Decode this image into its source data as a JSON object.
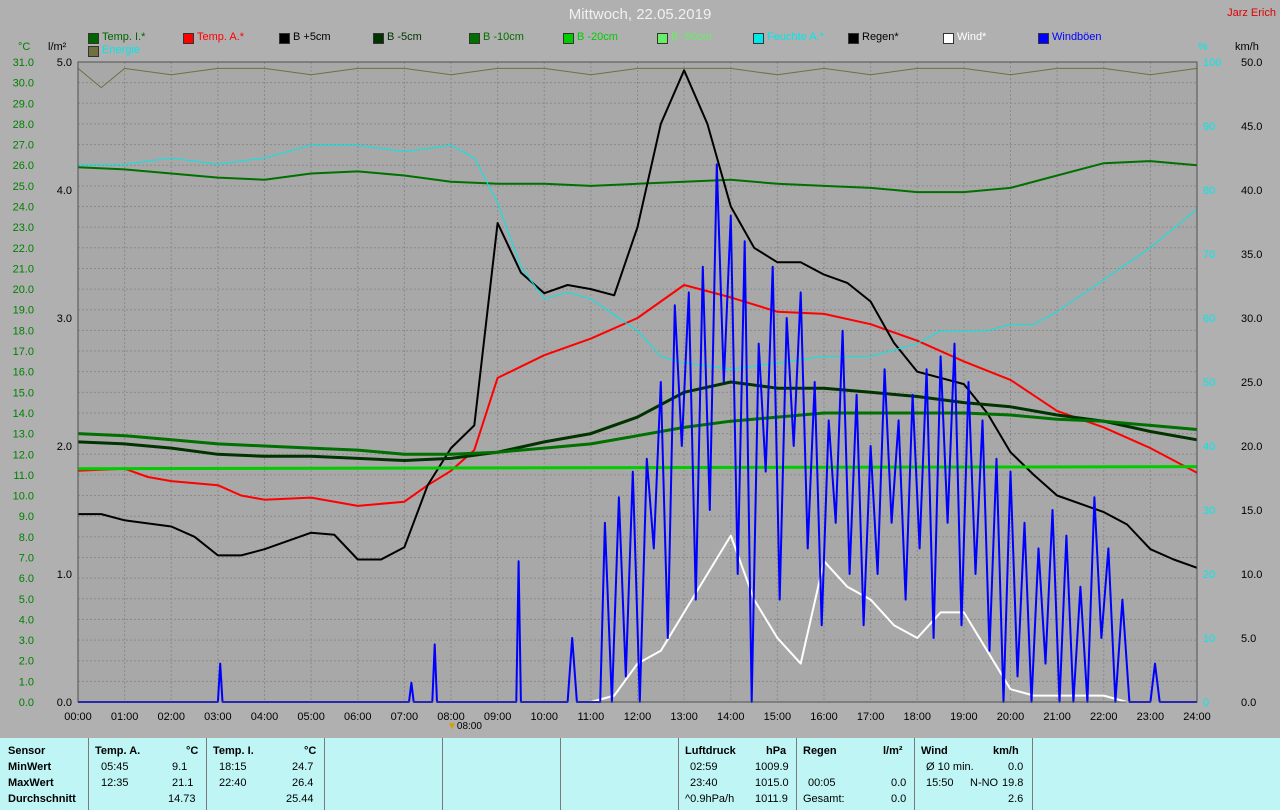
{
  "title": "Mittwoch, 22.05.2019",
  "author": "Jarz Erich",
  "units": {
    "left_temp": "°C",
    "left_rain": "l/m²",
    "right_pct": "%",
    "right_wind": "km/h"
  },
  "legend": [
    {
      "label": "Temp. I.*",
      "color": "#006400"
    },
    {
      "label": "Temp. A.*",
      "color": "#ff0000"
    },
    {
      "label": "B +5cm",
      "color": "#000000"
    },
    {
      "label": "B -5cm",
      "color": "#003300"
    },
    {
      "label": "B -10cm",
      "color": "#007000"
    },
    {
      "label": "B -20cm",
      "color": "#00cc00"
    },
    {
      "label": "B -50cm",
      "color": "#66ee66"
    },
    {
      "label": "Feuchte A.*",
      "color": "#00e8e8"
    },
    {
      "label": "Regen*",
      "color": "#000000"
    },
    {
      "label": "Wind*",
      "color": "#ffffff"
    },
    {
      "label": "Windböen",
      "color": "#0000ff"
    },
    {
      "label": "Energie",
      "color": "#707040"
    }
  ],
  "marker_label": "08:00",
  "chart_data": {
    "type": "line",
    "x_ticks": [
      "00:00",
      "01:00",
      "02:00",
      "03:00",
      "04:00",
      "05:00",
      "06:00",
      "07:00",
      "08:00",
      "09:00",
      "10:00",
      "11:00",
      "12:00",
      "13:00",
      "14:00",
      "15:00",
      "16:00",
      "17:00",
      "18:00",
      "19:00",
      "20:00",
      "21:00",
      "22:00",
      "23:00",
      "24:00"
    ],
    "temp_ticks": [
      "31.0",
      "30.0",
      "29.0",
      "28.0",
      "27.0",
      "26.0",
      "25.0",
      "24.0",
      "23.0",
      "22.0",
      "21.0",
      "20.0",
      "19.0",
      "18.0",
      "17.0",
      "16.0",
      "15.0",
      "14.0",
      "13.0",
      "12.0",
      "11.0",
      "10.0",
      "9.0",
      "8.0",
      "7.0",
      "6.0",
      "5.0",
      "4.0",
      "3.0",
      "2.0",
      "1.0",
      "0.0"
    ],
    "rain_ticks": [
      "5.0",
      "4.0",
      "3.0",
      "2.0",
      "1.0",
      "0.0"
    ],
    "pct_ticks": [
      "100",
      "90",
      "80",
      "70",
      "60",
      "50",
      "40",
      "30",
      "20",
      "10",
      "0"
    ],
    "wind_ticks": [
      "50.0",
      "45.0",
      "40.0",
      "35.0",
      "30.0",
      "25.0",
      "20.0",
      "15.0",
      "10.0",
      "5.0",
      "0.0"
    ],
    "temp_range": [
      0,
      31
    ],
    "pct_range": [
      0,
      100
    ],
    "wind_range": [
      0,
      50
    ],
    "series": [
      {
        "name": "Temp. I.*",
        "axis": "temp",
        "color": "#007000",
        "width": 2,
        "x": [
          0,
          1,
          2,
          3,
          4,
          5,
          6,
          7,
          8,
          9,
          10,
          11,
          12,
          13,
          14,
          15,
          16,
          17,
          18,
          19,
          20,
          21,
          22,
          23,
          24
        ],
        "y": [
          25.9,
          25.8,
          25.6,
          25.4,
          25.3,
          25.6,
          25.7,
          25.5,
          25.2,
          25.1,
          25.1,
          25.0,
          25.1,
          25.2,
          25.3,
          25.1,
          25.0,
          24.9,
          24.7,
          24.7,
          24.9,
          25.5,
          26.1,
          26.2,
          26.0
        ]
      },
      {
        "name": "Temp. A.*",
        "axis": "temp",
        "color": "#ff0000",
        "width": 2,
        "x": [
          0,
          1,
          1.5,
          2,
          3,
          3.5,
          4,
          5,
          6,
          7,
          7.5,
          8,
          8.5,
          9,
          10,
          11,
          12,
          13,
          14,
          15,
          16,
          17,
          18,
          19,
          20,
          21,
          22,
          23,
          24
        ],
        "y": [
          11.2,
          11.3,
          10.9,
          10.7,
          10.5,
          10.0,
          9.8,
          9.9,
          9.5,
          9.7,
          10.5,
          11.2,
          12.2,
          15.7,
          16.8,
          17.6,
          18.6,
          20.2,
          19.6,
          18.9,
          18.8,
          18.3,
          17.5,
          16.5,
          15.6,
          14.1,
          13.3,
          12.3,
          11.1
        ]
      },
      {
        "name": "B +5cm",
        "axis": "temp",
        "color": "#000000",
        "width": 2,
        "x": [
          0,
          0.5,
          1,
          2,
          2.5,
          3,
          3.5,
          4,
          5,
          5.5,
          6,
          6.5,
          7,
          7.5,
          8,
          8.5,
          9,
          9.5,
          10,
          10.5,
          11,
          11.5,
          12,
          12.5,
          13,
          13.5,
          14,
          14.5,
          15,
          15.5,
          16,
          16.5,
          17,
          17.5,
          18,
          19,
          19.5,
          20,
          20.5,
          21,
          22,
          22.5,
          23,
          23.5,
          24
        ],
        "y": [
          9.1,
          9.1,
          8.8,
          8.5,
          8.0,
          7.1,
          7.1,
          7.4,
          8.2,
          8.1,
          6.9,
          6.9,
          7.5,
          10.5,
          12.3,
          13.4,
          23.2,
          20.8,
          19.8,
          20.2,
          20.0,
          19.7,
          23.0,
          28.0,
          30.6,
          28.0,
          24.0,
          22.0,
          21.3,
          21.3,
          20.7,
          20.3,
          19.4,
          17.4,
          16.0,
          15.4,
          14.0,
          12.1,
          11.0,
          10.0,
          9.2,
          8.6,
          7.4,
          6.9,
          6.5
        ]
      },
      {
        "name": "B -5cm",
        "axis": "temp",
        "color": "#003300",
        "width": 3,
        "x": [
          0,
          1,
          2,
          3,
          4,
          5,
          6,
          7,
          8,
          9,
          10,
          11,
          12,
          13,
          14,
          15,
          16,
          17,
          18,
          19,
          20,
          21,
          22,
          23,
          24
        ],
        "y": [
          12.6,
          12.5,
          12.3,
          12.0,
          11.9,
          11.9,
          11.8,
          11.7,
          11.8,
          12.1,
          12.6,
          13.0,
          13.8,
          15.0,
          15.5,
          15.2,
          15.2,
          15.0,
          14.8,
          14.5,
          14.3,
          13.9,
          13.6,
          13.1,
          12.7
        ]
      },
      {
        "name": "B -10cm",
        "axis": "temp",
        "color": "#007000",
        "width": 3,
        "x": [
          0,
          1,
          2,
          3,
          4,
          5,
          6,
          7,
          8,
          9,
          10,
          11,
          12,
          13,
          14,
          15,
          16,
          17,
          18,
          19,
          20,
          21,
          22,
          23,
          24
        ],
        "y": [
          13.0,
          12.9,
          12.7,
          12.5,
          12.4,
          12.3,
          12.2,
          12.0,
          12.0,
          12.1,
          12.3,
          12.5,
          12.9,
          13.3,
          13.6,
          13.8,
          14.0,
          14.0,
          14.0,
          14.0,
          13.9,
          13.7,
          13.6,
          13.4,
          13.2
        ]
      },
      {
        "name": "B -20cm",
        "axis": "temp",
        "color": "#00cc00",
        "width": 3,
        "x": [
          0,
          24
        ],
        "y": [
          11.3,
          11.4
        ]
      },
      {
        "name": "Feuchte A.*",
        "axis": "pct",
        "color": "#00e8e8",
        "width": 1,
        "x": [
          0,
          1,
          2,
          3,
          4,
          5,
          6,
          7,
          8,
          8.5,
          9,
          9.5,
          10,
          10.5,
          11,
          12,
          12.5,
          13,
          14,
          15,
          16,
          17,
          18,
          18.5,
          19,
          19.5,
          20,
          20.5,
          21,
          22,
          23,
          24
        ],
        "y": [
          84,
          84,
          85,
          84,
          85,
          87,
          87,
          86,
          87,
          85,
          78,
          68,
          63,
          64,
          63,
          58,
          54,
          53,
          52,
          53,
          54,
          54,
          56,
          58,
          58,
          58,
          59,
          59,
          61,
          66,
          71,
          77
        ]
      },
      {
        "name": "Energie",
        "axis": "pct",
        "color": "#707040",
        "width": 1,
        "x": [
          0,
          0.5,
          1,
          2,
          3,
          4,
          5,
          6,
          7,
          8,
          9,
          10,
          11,
          12,
          13,
          14,
          15,
          16,
          17,
          18,
          19,
          20,
          21,
          22,
          23,
          24
        ],
        "y": [
          99,
          96,
          99,
          98,
          99,
          99,
          98,
          99,
          99,
          98,
          99,
          99,
          98,
          99,
          99,
          99,
          98,
          99,
          98,
          99,
          99,
          98,
          99,
          99,
          98,
          99
        ]
      },
      {
        "name": "Wind*",
        "axis": "wind",
        "color": "#ffffff",
        "width": 2,
        "x": [
          0,
          11,
          11.5,
          12,
          12.5,
          13,
          13.5,
          14,
          14.5,
          15,
          15.5,
          16,
          16.5,
          17,
          17.5,
          18,
          18.5,
          19,
          19.5,
          20,
          20.5,
          21,
          22,
          22.5,
          24
        ],
        "y": [
          0,
          0,
          0.5,
          3,
          4,
          7,
          10,
          13,
          8,
          5,
          3,
          11,
          9,
          8,
          6,
          5,
          7,
          7,
          4,
          1,
          0.5,
          0.5,
          0.5,
          0,
          0
        ]
      },
      {
        "name": "Windböen",
        "axis": "wind",
        "color": "#0000ff",
        "width": 2,
        "x": [
          0,
          3,
          3.05,
          3.1,
          7.1,
          7.15,
          7.2,
          7.6,
          7.65,
          7.7,
          9.4,
          9.45,
          9.5,
          10.5,
          10.6,
          10.7,
          11.2,
          11.3,
          11.45,
          11.6,
          11.75,
          11.9,
          12.05,
          12.2,
          12.35,
          12.5,
          12.65,
          12.8,
          12.95,
          13.1,
          13.25,
          13.4,
          13.55,
          13.7,
          13.85,
          14.0,
          14.15,
          14.3,
          14.45,
          14.6,
          14.75,
          14.9,
          15.05,
          15.2,
          15.35,
          15.5,
          15.65,
          15.8,
          15.95,
          16.1,
          16.25,
          16.4,
          16.55,
          16.7,
          16.85,
          17.0,
          17.15,
          17.3,
          17.45,
          17.6,
          17.75,
          17.9,
          18.05,
          18.2,
          18.35,
          18.5,
          18.65,
          18.8,
          18.95,
          19.1,
          19.25,
          19.4,
          19.55,
          19.7,
          19.85,
          20.0,
          20.15,
          20.3,
          20.45,
          20.6,
          20.75,
          20.9,
          21.05,
          21.2,
          21.35,
          21.5,
          21.65,
          21.8,
          21.95,
          22.1,
          22.25,
          22.4,
          22.55,
          22.7,
          23.0,
          23.1,
          23.2,
          24
        ],
        "y": [
          0,
          0,
          3,
          0,
          0,
          1.5,
          0,
          0,
          4.5,
          0,
          0,
          11,
          0,
          0,
          5,
          0,
          0,
          14,
          0,
          16,
          2,
          18,
          0,
          19,
          12,
          25,
          5,
          31,
          20,
          32,
          8,
          34,
          15,
          42,
          25,
          38,
          10,
          36,
          0,
          28,
          18,
          34,
          8,
          30,
          20,
          32,
          12,
          25,
          6,
          22,
          14,
          29,
          10,
          24,
          6,
          20,
          10,
          26,
          14,
          22,
          8,
          24,
          12,
          26,
          5,
          27,
          14,
          28,
          6,
          25,
          10,
          22,
          4,
          19,
          0,
          18,
          2,
          14,
          0,
          12,
          3,
          15,
          0,
          13,
          0,
          9,
          0,
          16,
          5,
          12,
          0,
          8,
          0,
          0,
          0,
          3,
          0,
          0
        ]
      }
    ],
    "rain_bars": []
  },
  "stats": {
    "headers": {
      "sensor": "Sensor",
      "temp_a": "Temp. A.",
      "temp_a_unit": "°C",
      "temp_i": "Temp. I.",
      "temp_i_unit": "°C",
      "luftdruck": "Luftdruck",
      "hpa": "hPa",
      "regen": "Regen",
      "regen_unit": "l/m²",
      "wind": "Wind",
      "wind_unit": "km/h"
    },
    "rows": {
      "min": "MinWert",
      "max": "MaxWert",
      "avg": "Durchschnitt"
    },
    "temp_a": {
      "min_time": "05:45",
      "min": "9.1",
      "max_time": "12:35",
      "max": "21.1",
      "avg": "14.73"
    },
    "temp_i": {
      "min_time": "18:15",
      "min": "24.7",
      "max_time": "22:40",
      "max": "26.4",
      "avg": "25.44"
    },
    "luftdruck": {
      "min_time": "02:59",
      "min": "1009.9",
      "max_time": "23:40",
      "max": "1015.0",
      "trend_label": "^0.9hPa/h",
      "avg": "1011.9"
    },
    "regen": {
      "time": "00:05",
      "value": "0.0",
      "total_label": "Gesamt:",
      "total": "0.0"
    },
    "wind": {
      "avg_label": "Ø 10 min.",
      "avg": "0.0",
      "max_time": "15:50",
      "max_dir": "N-NO",
      "max": "19.8",
      "mean": "2.6"
    }
  }
}
